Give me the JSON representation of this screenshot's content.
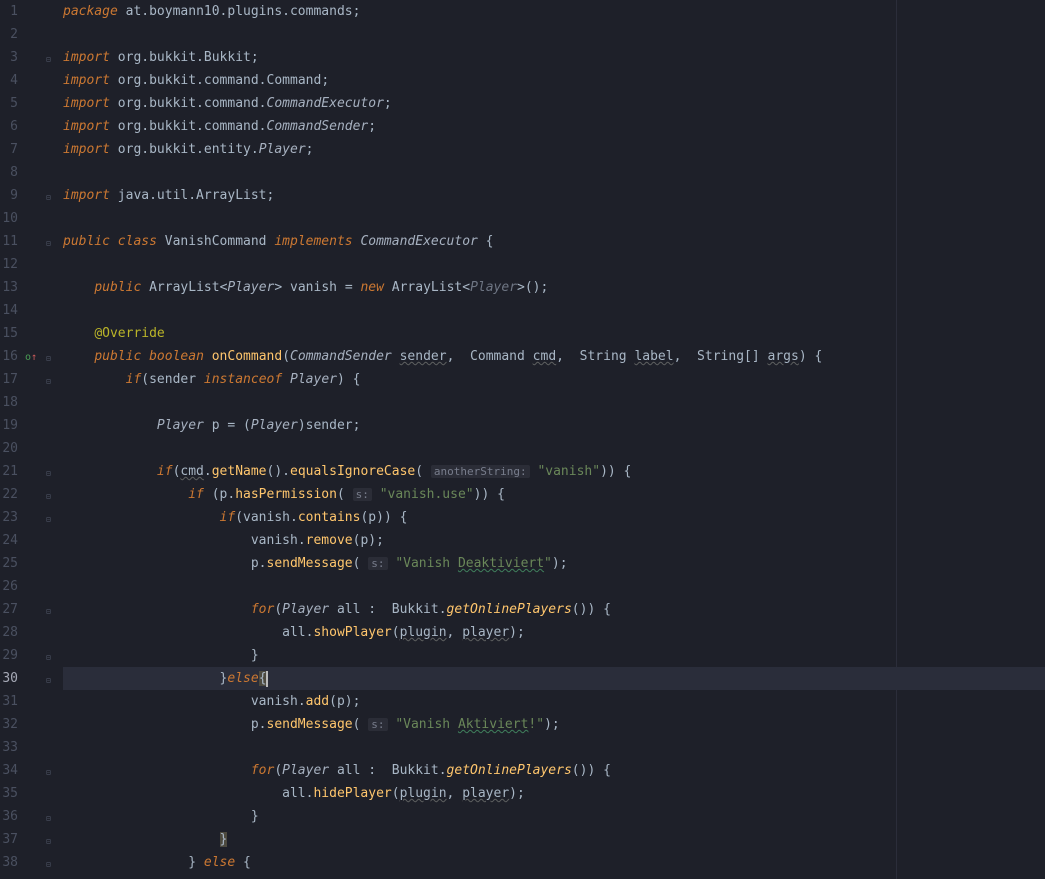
{
  "lines": {
    "l1": {
      "n": "1"
    },
    "l2": {
      "n": "2"
    },
    "l3": {
      "n": "3"
    },
    "l4": {
      "n": "4"
    },
    "l5": {
      "n": "5"
    },
    "l6": {
      "n": "6"
    },
    "l7": {
      "n": "7"
    },
    "l8": {
      "n": "8"
    },
    "l9": {
      "n": "9"
    },
    "l10": {
      "n": "10"
    },
    "l11": {
      "n": "11"
    },
    "l12": {
      "n": "12"
    },
    "l13": {
      "n": "13"
    },
    "l14": {
      "n": "14"
    },
    "l15": {
      "n": "15"
    },
    "l16": {
      "n": "16"
    },
    "l17": {
      "n": "17"
    },
    "l18": {
      "n": "18"
    },
    "l19": {
      "n": "19"
    },
    "l20": {
      "n": "20"
    },
    "l21": {
      "n": "21"
    },
    "l22": {
      "n": "22"
    },
    "l23": {
      "n": "23"
    },
    "l24": {
      "n": "24"
    },
    "l25": {
      "n": "25"
    },
    "l26": {
      "n": "26"
    },
    "l27": {
      "n": "27"
    },
    "l28": {
      "n": "28"
    },
    "l29": {
      "n": "29"
    },
    "l30": {
      "n": "30"
    },
    "l31": {
      "n": "31"
    },
    "l32": {
      "n": "32"
    },
    "l33": {
      "n": "33"
    },
    "l34": {
      "n": "34"
    },
    "l35": {
      "n": "35"
    },
    "l36": {
      "n": "36"
    },
    "l37": {
      "n": "37"
    },
    "l38": {
      "n": "38"
    }
  },
  "kw": {
    "package": "package",
    "import": "import",
    "public": "public",
    "class": "class",
    "implements": "implements",
    "new": "new",
    "boolean": "boolean",
    "if": "if",
    "instanceof": "instanceof",
    "for": "for",
    "else": "else"
  },
  "tok": {
    "pkgname": " at.boymann10.plugins.commands",
    "imp1": " org.bukkit.Bukkit",
    "imp2": " org.bukkit.command.",
    "imp3": " org.bukkit.entity.",
    "imp4": " java.util.ArrayList",
    "Command": "Command",
    "CommandExecutor": "CommandExecutor",
    "CommandSender": "CommandSender",
    "Player": "Player",
    "VanishCommand": " VanishCommand ",
    "ArrayList": " ArrayList",
    "ArrayList2": " ArrayList",
    "vanish": " vanish ",
    "eq": "= ",
    "lt": "<",
    "gt": ">",
    "parens": "()",
    "semi": ";",
    "ob": " {",
    "cb": "}",
    "Override": "@Override",
    "onCommand": " onCommand",
    "CommandSenderP": "CommandSender",
    "sender": "sender",
    "CommandP": " Command ",
    "cmd": "cmd",
    "StringP": " String ",
    "label": "label",
    "StringArr": " String",
    "brackets": "[] ",
    "args": "args",
    "senderVar": "sender",
    "PlayerCast": "Player",
    "p": "p",
    "pDecl": " p ",
    "eqp": "= (",
    "closeCast": ")",
    "senderEnd": "sender",
    "cmdVar": "cmd",
    "getName": "getName",
    "equalsIgnoreCase": "equalsIgnoreCase",
    "anotherString": "anotherString:",
    "vanishStr": "\"vanish\"",
    "hasPermission": "hasPermission",
    "sHint": "s:",
    "vanishUse": "\"vanish.use\"",
    "vanishVar": "vanish",
    "contains": "contains",
    "remove": "remove",
    "add": "add",
    "sendMessage": "sendMessage",
    "msgDeakt": "\"Vanish ",
    "Deaktiviert": "Deaktiviert",
    "msgDeaktEnd": "\"",
    "msgAkt": "\"Vanish ",
    "Aktiviert": "Aktiviert",
    "msgAktEnd": "!\"",
    "all": " all ",
    "colon": ": ",
    "Bukkit": " Bukkit",
    "getOnlinePlayers": "getOnlinePlayers",
    "allVar": "all",
    "showPlayer": "showPlayer",
    "hidePlayer": "hidePlayer",
    "plugin": "plugin",
    "player": "player",
    "comma": ", ",
    "dot": ".",
    "op": "(",
    "cp": ")",
    "sp1": "    ",
    "sp2": "        ",
    "sp3": "            ",
    "sp4": "                ",
    "sp5": "                    ",
    "sp6": "                        ",
    "sp7": "                            "
  }
}
